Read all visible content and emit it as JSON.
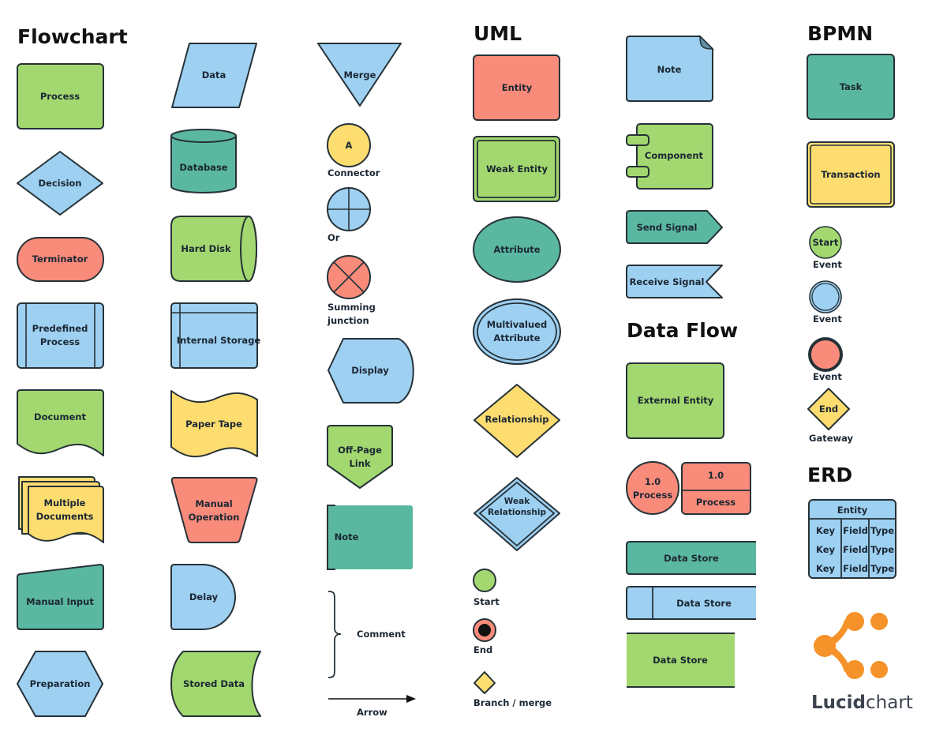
{
  "colors": {
    "green": "#a2d86f",
    "blue": "#9ed0f2",
    "teal": "#5bb8a0",
    "red": "#f98b7b",
    "yellow": "#fddc70",
    "outline": "#263238",
    "logo_orange": "#f5922a",
    "logo_text": "#3d4450"
  },
  "sections": {
    "flowchart": "Flowchart",
    "uml": "UML",
    "data_flow": "Data Flow",
    "bpmn": "BPMN",
    "erd": "ERD"
  },
  "flowchart": {
    "col1": {
      "process": "Process",
      "decision": "Decision",
      "terminator": "Terminator",
      "predefined_process": [
        "Predefined",
        "Process"
      ],
      "document": "Document",
      "multiple_documents": [
        "Multiple",
        "Documents"
      ],
      "manual_input": "Manual Input",
      "preparation": "Preparation"
    },
    "col2": {
      "data": "Data",
      "database": "Database",
      "hard_disk": "Hard Disk",
      "internal_storage": "Internal Storage",
      "paper_tape": "Paper Tape",
      "manual_operation": [
        "Manual",
        "Operation"
      ],
      "delay": "Delay",
      "stored_data": "Stored Data"
    },
    "col3": {
      "merge": "Merge",
      "connector_letter": "A",
      "connector": "Connector",
      "or": "Or",
      "summing_junction": [
        "Summing",
        "junction"
      ],
      "display": "Display",
      "off_page_link": [
        "Off-Page",
        "Link"
      ],
      "note": "Note",
      "comment": "Comment",
      "arrow": "Arrow"
    }
  },
  "uml": {
    "entity": "Entity",
    "weak_entity": "Weak Entity",
    "attribute": "Attribute",
    "multivalued_attribute": [
      "Multivalued",
      "Attribute"
    ],
    "relationship": "Relationship",
    "weak_relationship": [
      "Weak",
      "Relationship"
    ],
    "start": "Start",
    "end": "End",
    "branch_merge": "Branch / merge",
    "note": "Note",
    "component": "Component",
    "send_signal": "Send Signal",
    "receive_signal": "Receive Signal"
  },
  "data_flow": {
    "external_entity": "External Entity",
    "process_circle": [
      "1.0",
      "Process"
    ],
    "process_rect": [
      "1.0",
      "Process"
    ],
    "data_store_1": "Data Store",
    "data_store_2": "Data Store",
    "data_store_3": "Data Store"
  },
  "bpmn": {
    "task": "Task",
    "transaction": "Transaction",
    "start_event": [
      "Start",
      "Event"
    ],
    "intermediate_event": "Event",
    "end_event": "Event",
    "gateway": [
      "End",
      "Gateway"
    ]
  },
  "erd": {
    "header": "Entity",
    "rows": [
      [
        "Key",
        "Field",
        "Type"
      ],
      [
        "Key",
        "Field",
        "Type"
      ],
      [
        "Key",
        "Field",
        "Type"
      ]
    ]
  },
  "logo": {
    "bold": "Lucid",
    "light": "chart"
  }
}
